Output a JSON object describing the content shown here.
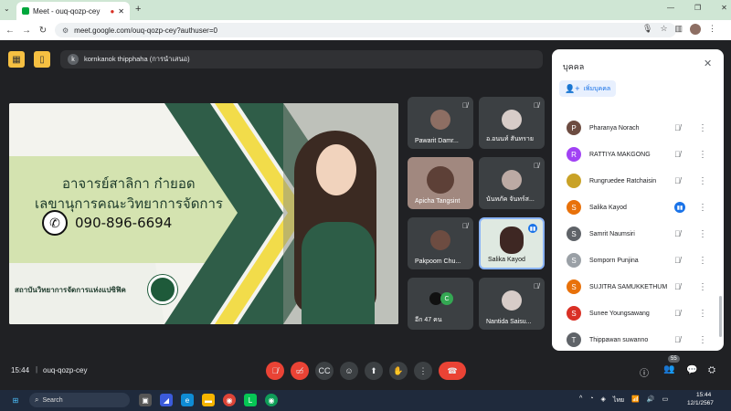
{
  "browser": {
    "tab_title": "Meet - ouq-qozp-cey",
    "url": "meet.google.com/ouq-qozp-cey?authuser=0"
  },
  "presenter": {
    "avatar_letter": "k",
    "text": "kornkanok thipphaha (การนำเสนอ)"
  },
  "slide": {
    "line1": "อาจารย์สาลิกา ก๋ายอด",
    "line2": "เลขานุการคณะวิทยาการจัดการ",
    "phone": "090-896-6694",
    "org": "สถาบันวิทยาการจัดการแห่งแปซิฟิค"
  },
  "tiles": [
    {
      "name": "Pawarit Damr..."
    },
    {
      "name": "อ.อนนท์ สันทราย"
    },
    {
      "name": "Apicha Tangsint"
    },
    {
      "name": "นันทภัค จันทร์ส..."
    },
    {
      "name": "Pakpoom Chu..."
    },
    {
      "name": "Salika Kayod"
    },
    {
      "name": "อีก 47 คน",
      "badge": "C"
    },
    {
      "name": "Nantida Saisu..."
    }
  ],
  "panel": {
    "title": "บุคคล",
    "add_label": "เพิ่มบุคคล",
    "people": [
      {
        "name": "Pharanya Norach",
        "letter": "P",
        "color": "#6d4c41"
      },
      {
        "name": "RATTIYA MAKGONG",
        "letter": "R",
        "color": "#a142f4"
      },
      {
        "name": "Rungruedee Ratchaisin",
        "letter": "",
        "color": "#c9a227"
      },
      {
        "name": "Salika Kayod",
        "letter": "S",
        "color": "#e8710a"
      },
      {
        "name": "Samrit Naumsiri",
        "letter": "S",
        "color": "#5f6368"
      },
      {
        "name": "Somporn Punjina",
        "letter": "S",
        "color": "#9aa0a6"
      },
      {
        "name": "SUJITRA SAMUKKETHUM",
        "letter": "S",
        "color": "#e8710a"
      },
      {
        "name": "Sunee Youngsawang",
        "letter": "S",
        "color": "#d93025"
      },
      {
        "name": "Thippawan suwanno",
        "letter": "T",
        "color": "#5f6368"
      }
    ]
  },
  "bottom": {
    "time": "15:44",
    "separator": "|",
    "code": "ouq-qozp-cey",
    "people_count": "55"
  },
  "taskbar": {
    "search": "Search",
    "lang": "ไทย",
    "time": "15:44",
    "date": "12/1/2567"
  }
}
